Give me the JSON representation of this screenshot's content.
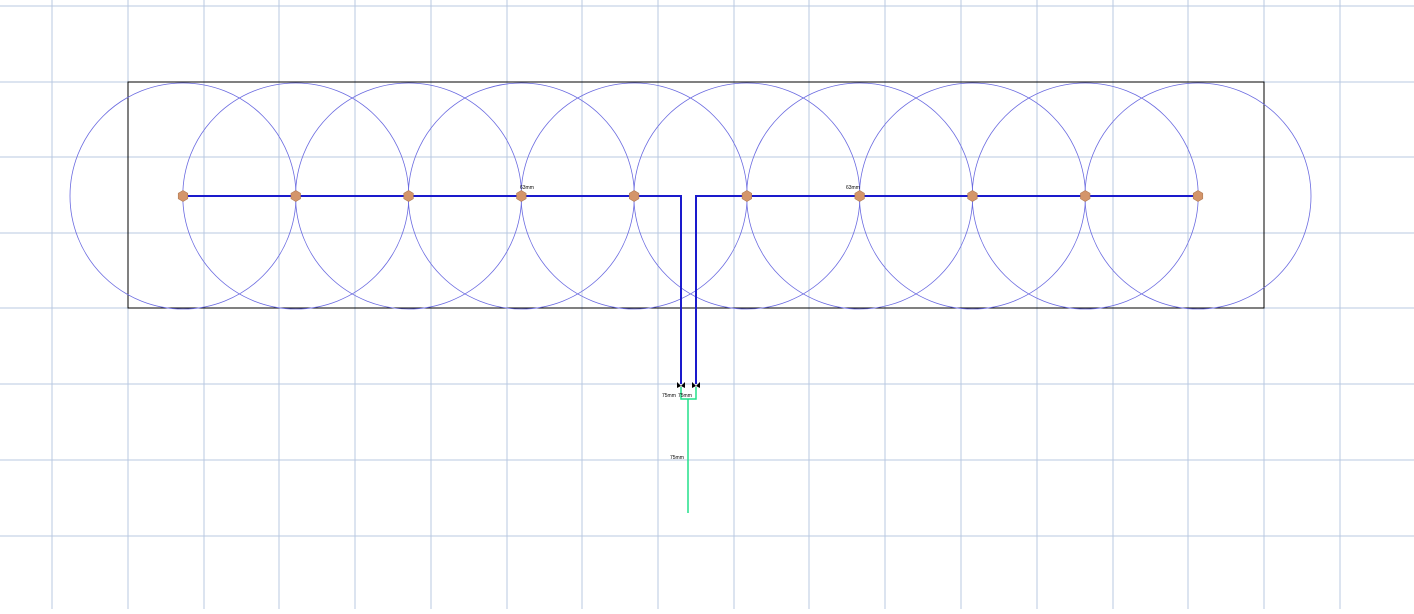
{
  "drawing": {
    "grid_color": "#b8c8e2",
    "room_outline_color": "#000000",
    "coverage_circle_color": "#6a6ae0",
    "main_pipe_color": "#1a1acc",
    "supply_pipe_color": "#22e08a",
    "sprinkler_head_color": "#d4956a",
    "sprinkler_head_stroke": "#b07a55",
    "sprinkler_heads": [
      {
        "label": "head-1"
      },
      {
        "label": "head-2"
      },
      {
        "label": "head-3"
      },
      {
        "label": "head-4"
      },
      {
        "label": "head-5"
      },
      {
        "label": "head-6"
      },
      {
        "label": "head-7"
      },
      {
        "label": "head-8"
      },
      {
        "label": "head-9"
      },
      {
        "label": "head-10"
      }
    ],
    "labels": {
      "left_branch_size": "63mm",
      "right_branch_size": "63mm",
      "left_riser_size": "75mm",
      "right_riser_size": "75mm",
      "supply_size": "75mm"
    }
  }
}
